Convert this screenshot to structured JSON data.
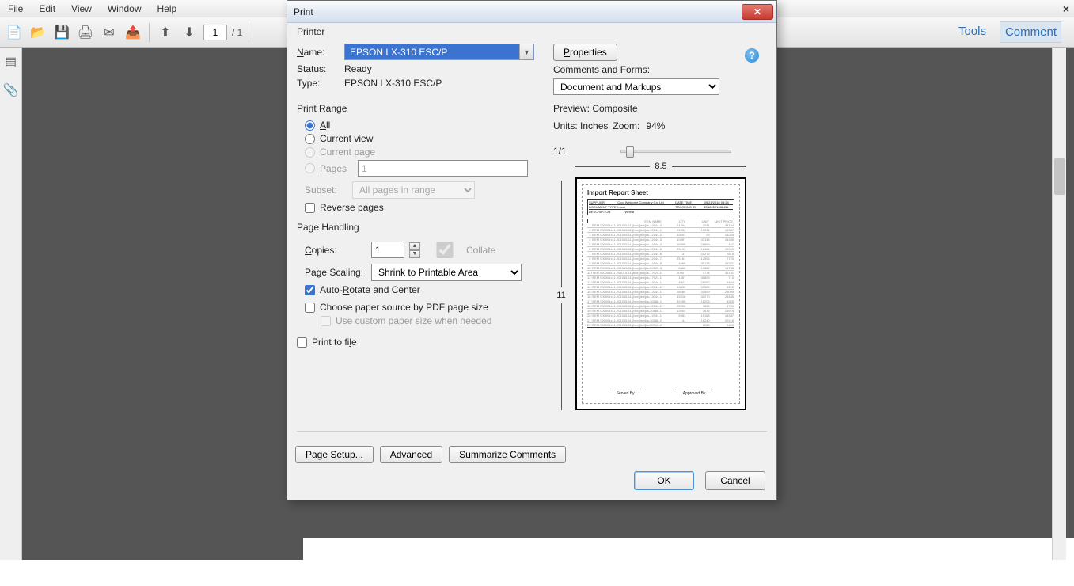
{
  "menu": {
    "file": "File",
    "edit": "Edit",
    "view": "View",
    "window": "Window",
    "help": "Help"
  },
  "toolbar": {
    "page_current": "1",
    "page_total": "/ 1",
    "tools": "Tools",
    "comment": "Comment"
  },
  "dialog": {
    "title": "Print",
    "printer_section": "Printer",
    "name_label": "Name:",
    "name_value": "EPSON LX-310 ESC/P",
    "properties": "Properties",
    "status_label": "Status:",
    "status_value": "Ready",
    "type_label": "Type:",
    "type_value": "EPSON LX-310 ESC/P",
    "comments_forms": "Comments and Forms:",
    "comments_forms_value": "Document and Markups",
    "print_range": "Print Range",
    "all": "All",
    "current_view": "Current view",
    "current_page": "Current page",
    "pages_label": "Pages",
    "pages_value": "1",
    "subset_label": "Subset:",
    "subset_value": "All pages in range",
    "reverse_pages": "Reverse pages",
    "page_handling": "Page Handling",
    "copies_label": "Copies:",
    "copies_value": "1",
    "collate": "Collate",
    "page_scaling_label": "Page Scaling:",
    "page_scaling_value": "Shrink to Printable Area",
    "auto_rotate": "Auto-Rotate and Center",
    "choose_paper": "Choose paper source by PDF page size",
    "custom_paper": "Use custom paper size when needed",
    "print_to_file": "Print to file",
    "preview_label": "Preview: Composite",
    "units": "Units:  Inches",
    "zoom_label": "Zoom:",
    "zoom_value": "94%",
    "page_indicator": "1/1",
    "width": "8.5",
    "height": "11",
    "doc_title": "Import Report Sheet",
    "served_by": "Served By",
    "approved_by": "Approved By",
    "page_setup": "Page Setup...",
    "advanced": "Advanced",
    "summarize": "Summarize Comments",
    "ok": "OK",
    "cancel": "Cancel"
  }
}
